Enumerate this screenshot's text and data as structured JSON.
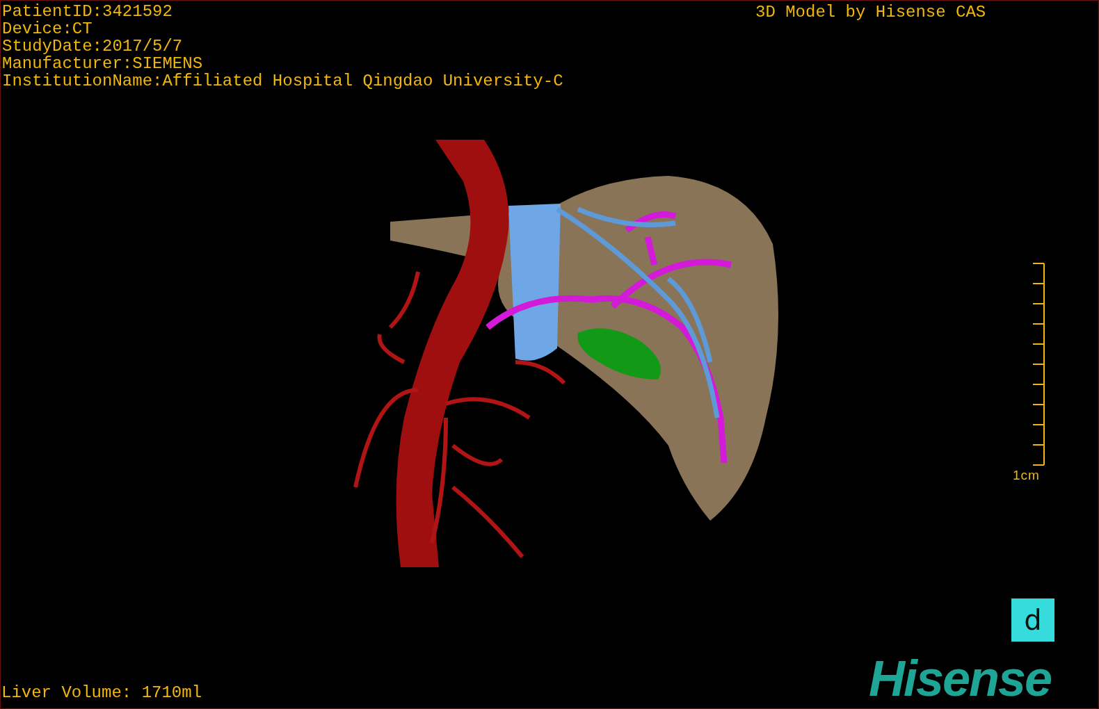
{
  "viewer": {
    "patient_info": [
      "PatientID:3421592",
      "Device:CT",
      "StudyDate:2017/5/7",
      "Manufacturer:SIEMENS",
      "InstitutionName:Affiliated Hospital Qingdao University-C"
    ],
    "model_credit": "3D Model by Hisense CAS",
    "scale_bar": {
      "label": "1cm"
    },
    "orientation_cube": {
      "label": "d"
    },
    "liver_volume": "Liver Volume: 1710ml",
    "logo": "Hisense"
  }
}
